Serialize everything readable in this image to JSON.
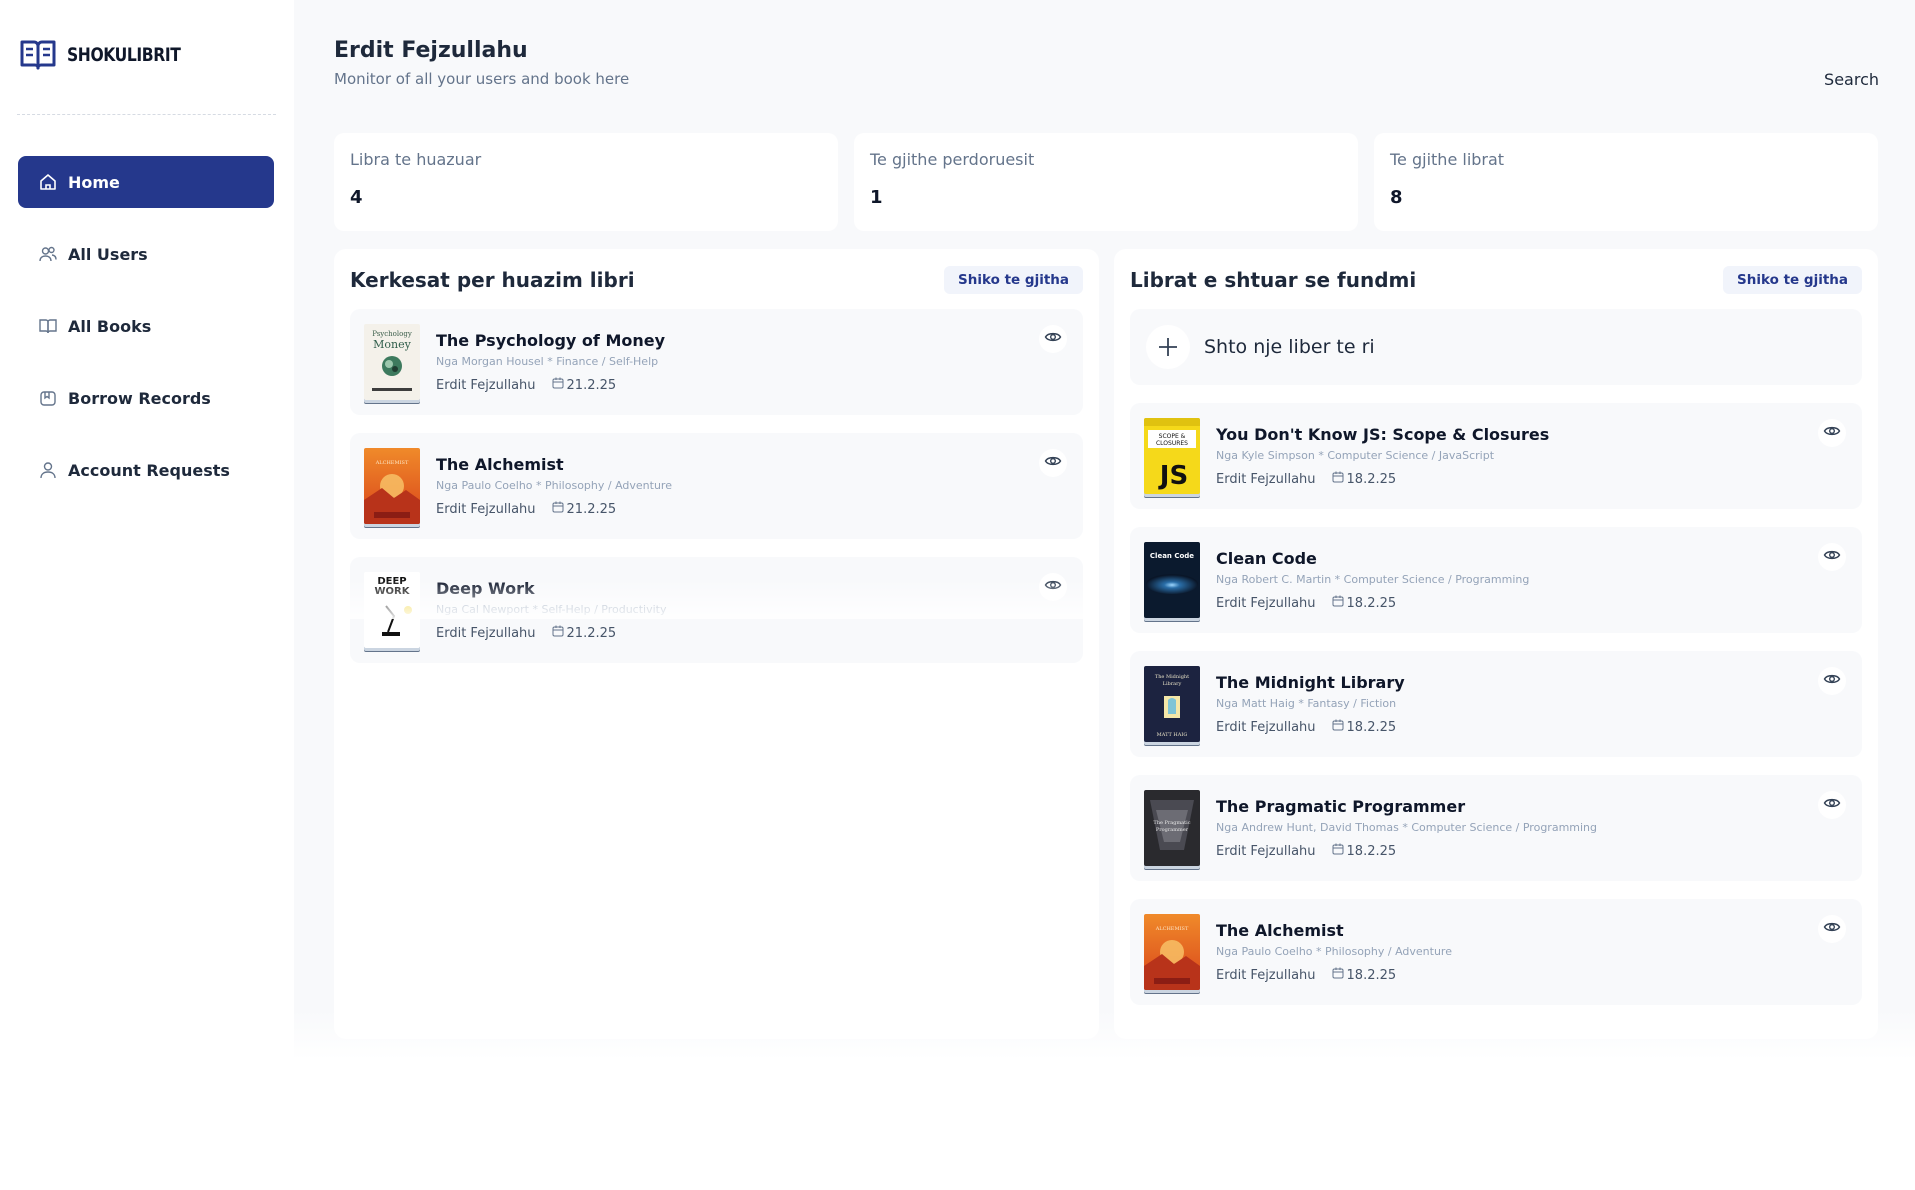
{
  "brand": {
    "name": "SHOKULIBRIT"
  },
  "sidebar": {
    "items": [
      {
        "label": "Home",
        "icon": "home-icon",
        "active": true
      },
      {
        "label": "All Users",
        "icon": "users-icon",
        "active": false
      },
      {
        "label": "All Books",
        "icon": "book-icon",
        "active": false
      },
      {
        "label": "Borrow Records",
        "icon": "bookmark-icon",
        "active": false
      },
      {
        "label": "Account Requests",
        "icon": "user-icon",
        "active": false
      }
    ]
  },
  "header": {
    "title": "Erdit Fejzullahu",
    "subtitle": "Monitor of all your users and book here",
    "search_label": "Search"
  },
  "stats": [
    {
      "label": "Libra te huazuar",
      "value": "4"
    },
    {
      "label": "Te gjithe perdoruesit",
      "value": "1"
    },
    {
      "label": "Te gjithe librat",
      "value": "8"
    }
  ],
  "borrow_requests": {
    "title": "Kerkesat per huazim libri",
    "see_all": "Shiko te gjitha",
    "items": [
      {
        "title": "The Psychology of Money",
        "meta": "Nga Morgan Housel * Finance / Self-Help",
        "user": "Erdit Fejzullahu",
        "date": "21.2.25",
        "cover": "psychology"
      },
      {
        "title": "The Alchemist",
        "meta": "Nga Paulo Coelho * Philosophy / Adventure",
        "user": "Erdit Fejzullahu",
        "date": "21.2.25",
        "cover": "alchemist"
      },
      {
        "title": "Deep Work",
        "meta": "Nga Cal Newport * Self-Help / Productivity",
        "user": "Erdit Fejzullahu",
        "date": "21.2.25",
        "cover": "deepwork"
      }
    ]
  },
  "recent_books": {
    "title": "Librat e shtuar se fundmi",
    "see_all": "Shiko te gjitha",
    "add_label": "Shto nje liber te ri",
    "items": [
      {
        "title": "You Don't Know JS: Scope & Closures",
        "meta": "Nga Kyle Simpson * Computer Science / JavaScript",
        "user": "Erdit Fejzullahu",
        "date": "18.2.25",
        "cover": "ydkjs"
      },
      {
        "title": "Clean Code",
        "meta": "Nga Robert C. Martin * Computer Science / Programming",
        "user": "Erdit Fejzullahu",
        "date": "18.2.25",
        "cover": "cleancode"
      },
      {
        "title": "The Midnight Library",
        "meta": "Nga Matt Haig * Fantasy / Fiction",
        "user": "Erdit Fejzullahu",
        "date": "18.2.25",
        "cover": "midnight"
      },
      {
        "title": "The Pragmatic Programmer",
        "meta": "Nga Andrew Hunt, David Thomas * Computer Science / Programming",
        "user": "Erdit Fejzullahu",
        "date": "18.2.25",
        "cover": "pragmatic"
      },
      {
        "title": "The Alchemist",
        "meta": "Nga Paulo Coelho * Philosophy / Adventure",
        "user": "Erdit Fejzullahu",
        "date": "18.2.25",
        "cover": "alchemist"
      }
    ]
  },
  "cover_texts": {
    "psychology": "The Psychology of Money",
    "psychology_author": "MORGAN HOUSEL",
    "alchemist": "THE ALCHEMIST",
    "alchemist_author": "Paulo Coelho",
    "deepwork": "DEEP WORK",
    "ydkjs": "SCOPE & CLOSURES",
    "ydkjs_mark": "JS",
    "cleancode": "Clean Code",
    "midnight": "The Midnight Library",
    "midnight_author": "MATT HAIG",
    "pragmatic": "The Pragmatic Programmer"
  },
  "colors": {
    "accent": "#25388c",
    "background": "#f8f9fb",
    "card": "#ffffff"
  }
}
